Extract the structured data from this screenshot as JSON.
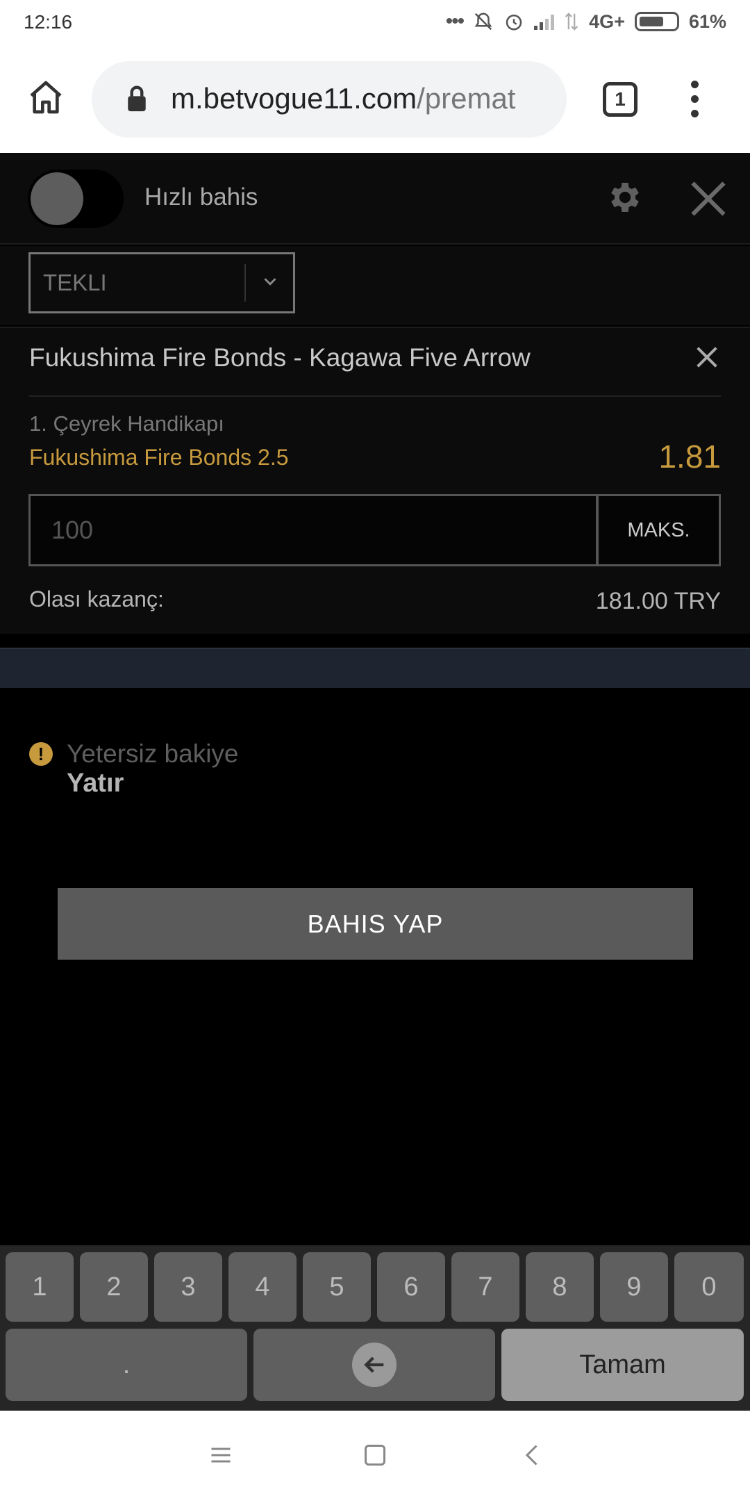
{
  "status_bar": {
    "time": "12:16",
    "network": "4G+",
    "battery": "61%"
  },
  "browser": {
    "url_domain": "m.betvogue11.com",
    "url_path": "/premat",
    "tab_count": "1",
    "icons": [
      "home-icon",
      "lock-icon",
      "tabs-icon",
      "more-vert-icon"
    ]
  },
  "betslip": {
    "quick_bet_label": "Hızlı bahis",
    "quick_bet_on": false,
    "bet_type": "TEKLI",
    "match": "Fukushima Fire Bonds - Kagawa Five Arrow",
    "market": "1. Çeyrek Handikapı",
    "selection": "Fukushima Fire Bonds 2.5",
    "odds": "1.81",
    "stake_placeholder": "100",
    "max_label": "MAKS.",
    "winnings_label": "Olası kazanç:",
    "winnings_value": "181.00 TRY",
    "warning": "Yetersiz bakiye",
    "deposit_link": "Yatır",
    "place_bet_label": "BAHIS YAP"
  },
  "keyboard": {
    "digits": [
      "1",
      "2",
      "3",
      "4",
      "5",
      "6",
      "7",
      "8",
      "9",
      "0"
    ],
    "decimal": ".",
    "done": "Tamam"
  },
  "colors": {
    "accent": "#c79a3e",
    "background": "#000000",
    "panel": "#0c0c0c",
    "band": "#1e2430",
    "button": "#5a5a5a"
  }
}
